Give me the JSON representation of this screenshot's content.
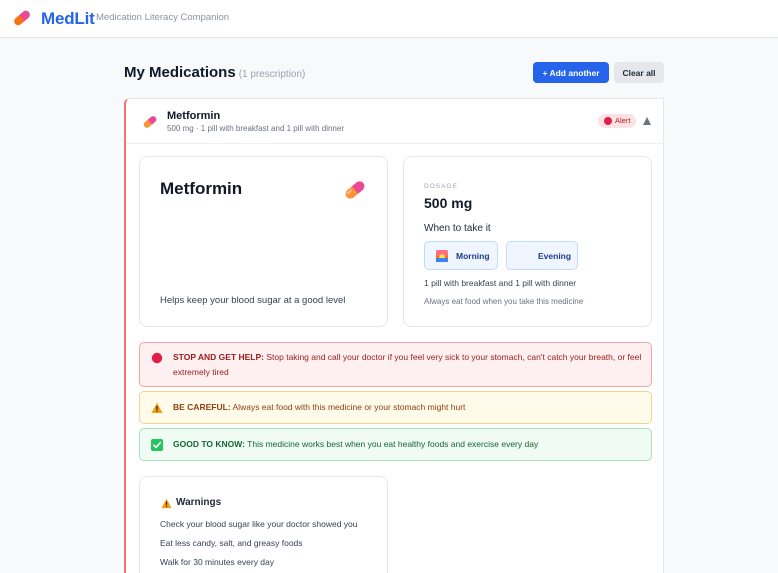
{
  "app": {
    "brand": "MedLit",
    "tagline": "Medication Literacy Companion"
  },
  "page": {
    "title": "My Medications",
    "count": "(1 prescription)",
    "add_label": "+ Add another",
    "clear_label": "Clear all"
  },
  "medication": {
    "name": "Metformin",
    "summary": "500 mg · 1 pill with breakfast and 1 pill with dinner",
    "alert_label": "Alert",
    "purpose": "Helps keep your blood sugar at a good level",
    "dosage_label": "DOSAGE",
    "dosage": "500 mg",
    "when_label": "When to take it",
    "times": [
      {
        "label": "Morning",
        "icon": "sunrise-icon"
      },
      {
        "label": "Evening",
        "icon": "moon-icon"
      }
    ],
    "instruction": "1 pill with breakfast and 1 pill with dinner",
    "food_note": "Always eat food when you take this medicine"
  },
  "banners": {
    "danger": {
      "strong": "STOP AND GET HELP:",
      "text": "Stop taking and call your doctor if you feel very sick to your stomach, can't catch your breath, or feel extremely tired"
    },
    "caution": {
      "strong": "BE CAREFUL:",
      "text": "Always eat food with this medicine or your stomach might hurt"
    },
    "info": {
      "strong": "GOOD TO KNOW:",
      "text": "This medicine works best when you eat healthy foods and exercise every day"
    }
  },
  "warnings": {
    "title": "Warnings",
    "items": [
      "Check your blood sugar like your doctor showed you",
      "Eat less candy, salt, and greasy foods",
      "Walk for 30 minutes every day"
    ]
  },
  "colors": {
    "accent": "#2563eb",
    "danger": "#e11d48",
    "caution": "#f59e0b",
    "success": "#22c55e"
  }
}
